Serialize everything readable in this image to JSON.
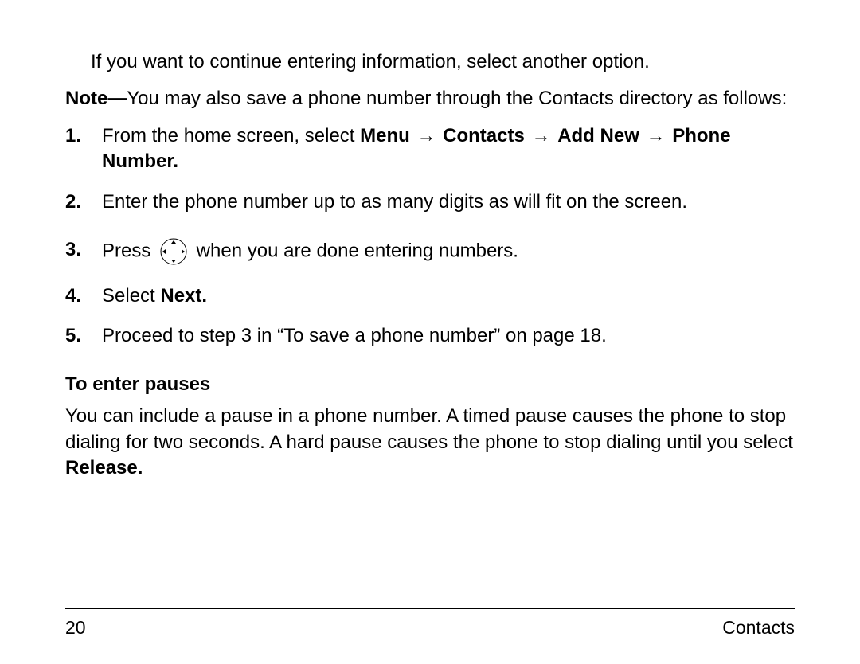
{
  "intro": "If you want to continue entering information, select another option.",
  "note": {
    "label": "Note—",
    "text": "You may also save a phone number through the Contacts directory as follows:"
  },
  "steps": {
    "s1": {
      "num": "1.",
      "pre": "From the home screen, select ",
      "menu": "Menu",
      "arrow": "→",
      "contacts": "Contacts",
      "addnew": "Add New",
      "phonenum": "Phone Number."
    },
    "s2": {
      "num": "2.",
      "text": "Enter the phone number up to as many digits as will fit on the screen."
    },
    "s3": {
      "num": "3.",
      "pre": "Press ",
      "post": " when you are done entering numbers."
    },
    "s4": {
      "num": "4.",
      "pre": "Select ",
      "next": "Next."
    },
    "s5": {
      "num": "5.",
      "text": "Proceed to step 3 in “To save a phone number” on page 18."
    }
  },
  "section": {
    "heading": "To enter pauses",
    "body_pre": "You can include a pause in a phone number. A timed pause causes the phone to stop dialing for two seconds. A hard pause causes the phone to stop dialing until you select ",
    "release": "Release."
  },
  "footer": {
    "page": "20",
    "chapter": "Contacts"
  },
  "icons": {
    "ok_button": "ok-direction-button-icon"
  }
}
